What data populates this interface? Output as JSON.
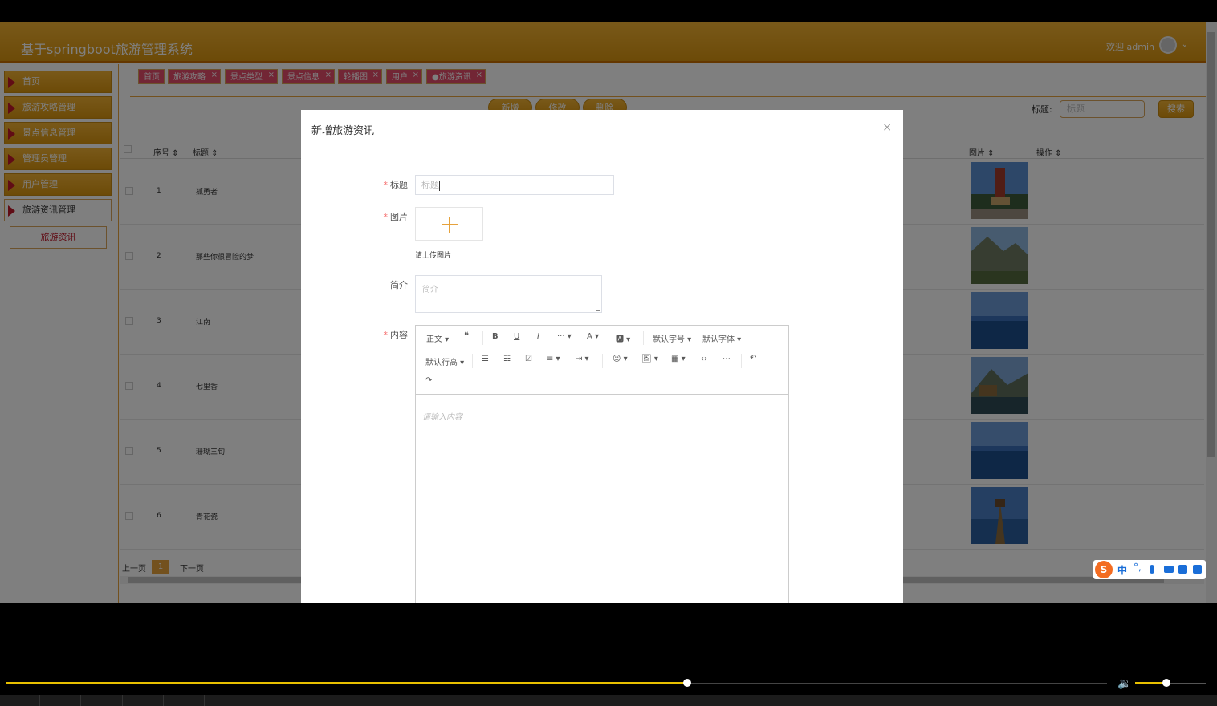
{
  "header": {
    "app_title": "基于springboot旅游管理系统",
    "welcome": "欢迎 admin"
  },
  "sidebar": {
    "items": [
      {
        "label": "首页"
      },
      {
        "label": "旅游攻略管理"
      },
      {
        "label": "景点信息管理"
      },
      {
        "label": "管理员管理"
      },
      {
        "label": "用户管理"
      },
      {
        "label": "旅游资讯管理"
      }
    ],
    "sub_item": "旅游资讯"
  },
  "tabs": [
    {
      "label": "首页"
    },
    {
      "label": "旅游攻略"
    },
    {
      "label": "景点类型"
    },
    {
      "label": "景点信息"
    },
    {
      "label": "轮播图"
    },
    {
      "label": "用户"
    },
    {
      "label": "●旅游资讯"
    }
  ],
  "toolbar": {
    "add_label": "新增",
    "edit_label": "修改",
    "delete_label": "删除",
    "search_label": "标题:",
    "search_placeholder": "标题",
    "search_button": "搜索"
  },
  "table": {
    "columns": [
      "序号",
      "标题",
      "图片",
      "操作"
    ],
    "rows": [
      {
        "num": "1",
        "title": "孤勇者"
      },
      {
        "num": "2",
        "title": "那些你很冒险的梦"
      },
      {
        "num": "3",
        "title": "江南"
      },
      {
        "num": "4",
        "title": "七里香"
      },
      {
        "num": "5",
        "title": "珊瑚三旬"
      },
      {
        "num": "6",
        "title": "青花瓷"
      }
    ]
  },
  "pager": {
    "prev": "上一页",
    "page": "1",
    "next": "下一页"
  },
  "dialog": {
    "title": "新增旅游资讯",
    "close": "×",
    "form": {
      "title_label": "标题",
      "title_placeholder": "标题",
      "image_label": "图片",
      "upload_hint": "请上传图片",
      "intro_label": "简介",
      "intro_placeholder": "简介",
      "content_label": "内容",
      "content_placeholder": "请输入内容"
    },
    "editor_toolbar": {
      "paragraph": "正文",
      "font_size": "默认字号",
      "font_family": "默认字体",
      "line_height": "默认行高"
    }
  },
  "ime": {
    "mode": "中",
    "punct": "°,"
  },
  "player": {
    "progress": 0.619,
    "volume": 0.44
  },
  "colors": {
    "accent": "#e6a23c",
    "tab_bg": "#e54c6b",
    "menu_marker": "#c0182a"
  }
}
